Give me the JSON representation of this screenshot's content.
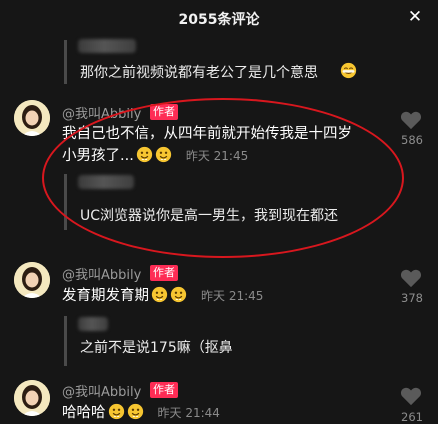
{
  "header": {
    "title": "2055条评论",
    "close_label": "✕"
  },
  "replies": [
    {
      "text": "那你之前视频说都有老公了是几个意思"
    },
    {
      "text": "UC浏览器说你是高一男生，我到现在都还"
    },
    {
      "text": "之前不是说175嘛（抠鼻"
    }
  ],
  "comments": [
    {
      "username": "@我叫Abbily",
      "badge": "作者",
      "line1": "我自己也不信，从四年前就开始传我是十四岁",
      "line2": "小男孩了...",
      "time": "昨天 21:45",
      "likes": "586"
    },
    {
      "username": "@我叫Abbily",
      "badge": "作者",
      "line1": "发育期发育期",
      "time": "昨天 21:45",
      "likes": "378"
    },
    {
      "username": "@我叫Abbily",
      "badge": "作者",
      "line1": "哈哈哈",
      "time": "昨天 21:44",
      "likes": "261"
    }
  ],
  "colors": {
    "background": "#161616",
    "badge": "#fe2c55",
    "highlight_circle": "#d8171e"
  },
  "icons": [
    "close-icon",
    "heart-icon",
    "smiling-face-emoji",
    "shy-face-emoji",
    "avatar-image"
  ]
}
